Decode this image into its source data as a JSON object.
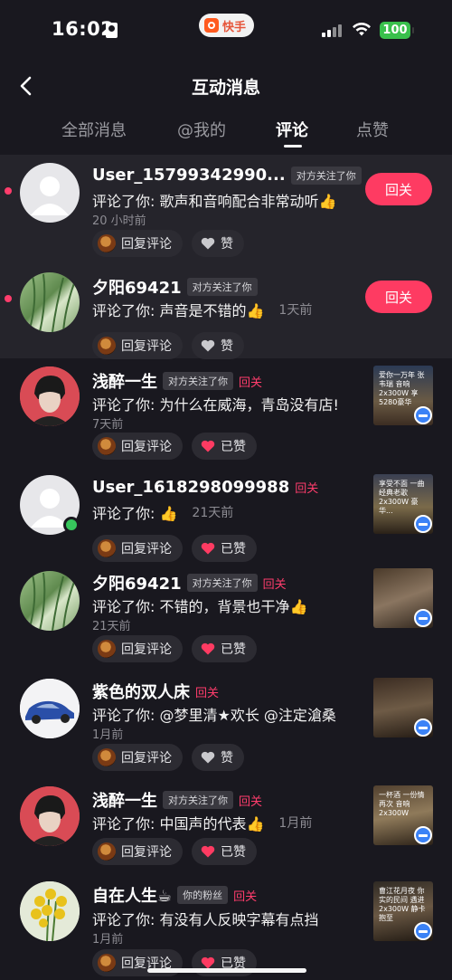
{
  "status_bar": {
    "time": "16:02",
    "app_pill": "快手",
    "battery": "100"
  },
  "header": {
    "title": "互动消息"
  },
  "tabs": [
    {
      "label": "全部消息"
    },
    {
      "label": "@我的"
    },
    {
      "label": "评论"
    },
    {
      "label": "点赞"
    }
  ],
  "active_tab": "评论",
  "items": [
    {
      "name": "User_15799342990...",
      "relation": "对方关注了你",
      "follow_back": "",
      "comment": "评论了你: 歌声和音响配合非常动听👍",
      "time": "20 小时前",
      "reply_label": "回复评论",
      "like_label": "赞",
      "liked": false,
      "button": "回关",
      "unread": true
    },
    {
      "name": "夕阳69421",
      "relation": "对方关注了你",
      "follow_back": "",
      "comment": "评论了你: 声音是不错的👍",
      "time": "1天前",
      "reply_label": "回复评论",
      "like_label": "赞",
      "liked": false,
      "button": "回关",
      "unread": true
    },
    {
      "name": "浅醉一生",
      "relation": "对方关注了你",
      "follow_back": "回关",
      "comment": "评论了你: 为什么在威海，青岛没有店!",
      "time": "7天前",
      "reply_label": "回复评论",
      "like_label": "已赞",
      "liked": true,
      "thumb_text": "爱你一万年 张韦瑞 音响 2x300W 享5280豪华"
    },
    {
      "name": "User_1618298099988",
      "relation": "",
      "follow_back": "回关",
      "comment": "评论了你: 👍",
      "time": "21天前",
      "reply_label": "回复评论",
      "like_label": "已赞",
      "liked": true,
      "thumb_text": "享受不面 一曲 经典老歌 2x300W 豪华..."
    },
    {
      "name": "夕阳69421",
      "relation": "对方关注了你",
      "follow_back": "回关",
      "comment": "评论了你: 不错的，背景也干净👍",
      "time": "21天前",
      "reply_label": "回复评论",
      "like_label": "已赞",
      "liked": true,
      "thumb_text": ""
    },
    {
      "name": "紫色的双人床",
      "relation": "",
      "follow_back": "回关",
      "comment": "评论了你: @梦里清★欢长 @注定滄桑",
      "time": "1月前",
      "reply_label": "回复评论",
      "like_label": "赞",
      "liked": false,
      "thumb_text": ""
    },
    {
      "name": "浅醉一生",
      "relation": "对方关注了你",
      "follow_back": "回关",
      "comment": "评论了你: 中国声的代表👍",
      "time": "1月前",
      "reply_label": "回复评论",
      "like_label": "已赞",
      "liked": true,
      "thumb_text": "一杯酒 一份情 再次 音响 2x300W"
    },
    {
      "name": "自在人生☕",
      "relation": "你的粉丝",
      "follow_back": "回关",
      "comment": "评论了你: 有没有人反映字幕有点挡",
      "time": "1月前",
      "reply_label": "回复评论",
      "like_label": "已赞",
      "liked": true,
      "thumb_text": "曹江花月夜 你实的民间 遇进 2x300W 静卡抱至"
    }
  ],
  "colors": {
    "accent": "#fe3b62",
    "background": "#19181f",
    "unread_bg": "#25242b",
    "online": "#37c65c"
  },
  "icons": [
    "back-icon",
    "heart-icon",
    "chat-icon",
    "wifi-icon",
    "signal-icon"
  ]
}
